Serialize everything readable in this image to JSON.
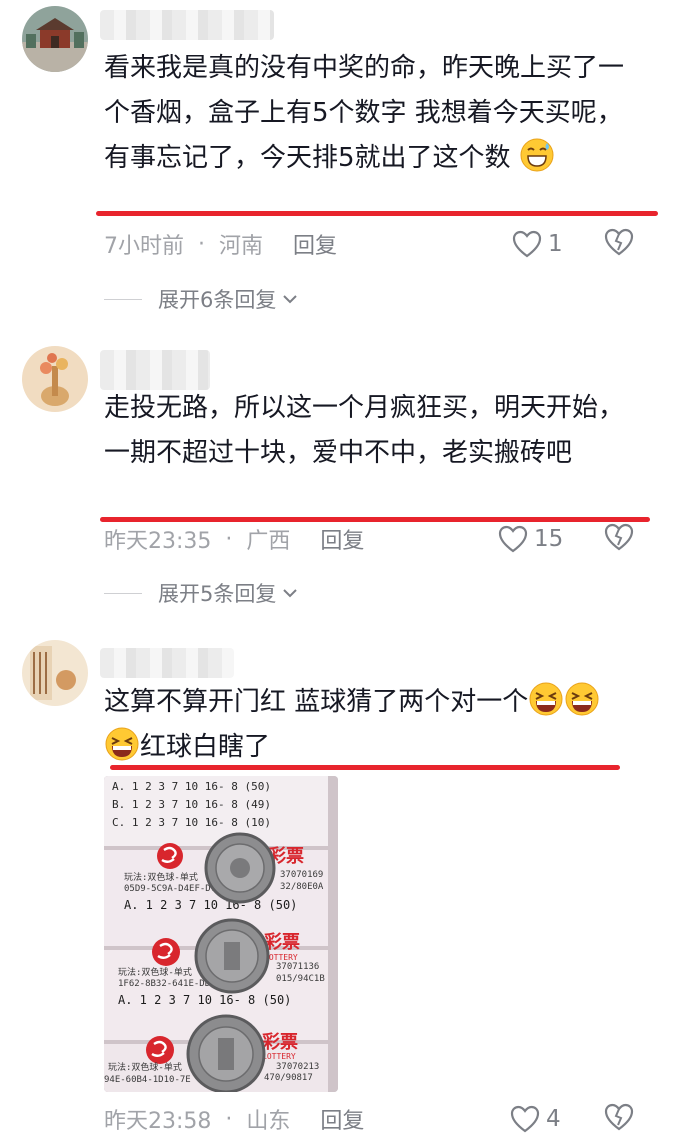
{
  "comments": [
    {
      "text": "看来我是真的没有中奖的命，昨天晚上买了一个香烟，盒子上有5个数字 我想着今天买呢，有事忘记了，今天排5就出了这个数",
      "time": "7小时前",
      "location": "河南",
      "reply_label": "回复",
      "likes": "1",
      "expand_label": "展开6条回复"
    },
    {
      "text": "走投无路，所以这一个月疯狂买，明天开始，一期不超过十块，爱中不中，老实搬砖吧",
      "time": "昨天23:35",
      "location": "广西",
      "reply_label": "回复",
      "likes": "15",
      "expand_label": "展开5条回复"
    },
    {
      "text_line1": "这算不算开门红 蓝球猜了两个对一个",
      "text_line2": "红球白瞎了",
      "time": "昨天23:58",
      "location": "山东",
      "reply_label": "回复",
      "likes": "4"
    }
  ],
  "ticket": {
    "rows_top": [
      "A. 1  2  3  7 10 16- 8 (50)",
      "B. 1  2  3  7 10 16- 8 (49)",
      "C. 1  2  3  7 10 16- 8 (10)"
    ],
    "logo_text": "彩票",
    "lottery_en": "LOTTERY",
    "play_label": "玩法:双色球-单式",
    "blocks": [
      {
        "code1": "05D9-5C9A-D4EF-D7B",
        "serial": "37070169",
        "code2": "32/80E0A",
        "row": "A. 1  2  3  7 10 16- 8 (50)"
      },
      {
        "code1": "1F62-8B32-641E-DD",
        "serial": "37071136",
        "code2": "015/94C1B",
        "row": "A. 1  2  3  7 10 16- 8 (50)"
      },
      {
        "code1": "94E-60B4-1D10-7E",
        "serial": "37070213",
        "code2": "470/90817",
        "row": ""
      }
    ]
  },
  "icons": {
    "like": "heart-outline-icon",
    "dislike": "broken-heart-icon",
    "expand": "chevron-down-icon",
    "emoji": "laughing-face-emoji"
  },
  "colors": {
    "underline": "#e8242d",
    "meta": "#a1a3a8",
    "accent": "#7c7f86"
  }
}
